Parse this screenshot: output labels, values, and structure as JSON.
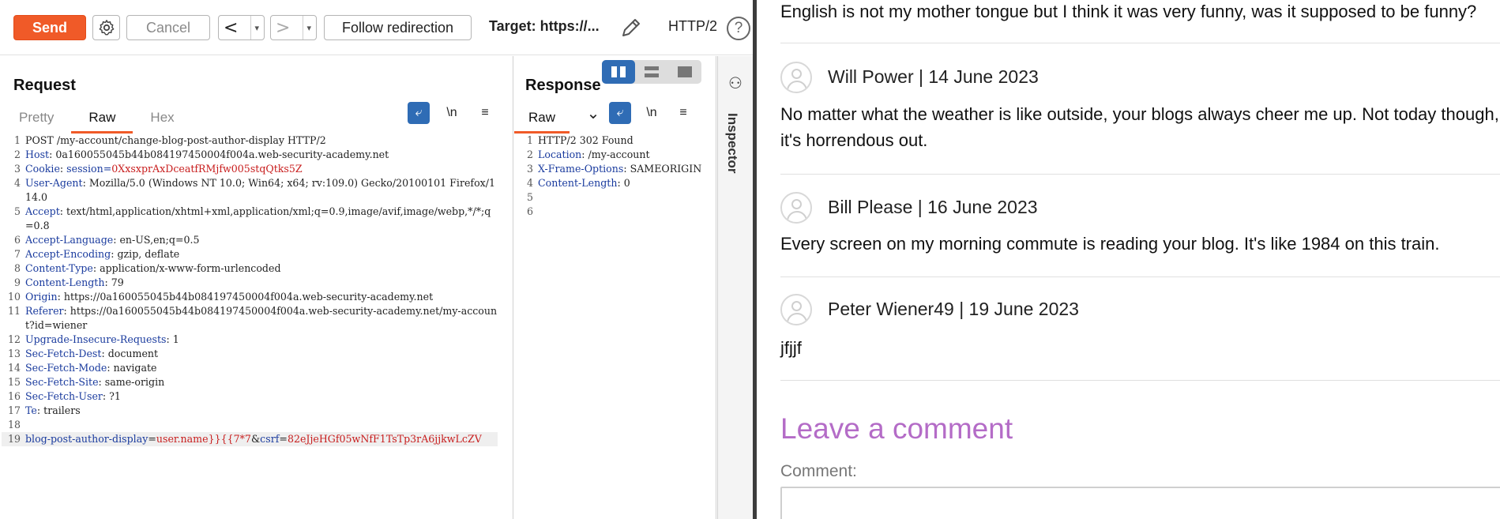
{
  "toolbar": {
    "send_label": "Send",
    "cancel_label": "Cancel",
    "back_label": "<",
    "forward_label": ">",
    "caret": "▾",
    "follow_label": "Follow redirection",
    "target_label": "Target: https://...",
    "http_version": "HTTP/2",
    "help_label": "?"
  },
  "request": {
    "title": "Request",
    "tabs": [
      {
        "label": "Pretty",
        "active": false
      },
      {
        "label": "Raw",
        "active": true
      },
      {
        "label": "Hex",
        "active": false
      }
    ],
    "wrap_icon": "⤶",
    "newline_icon": "\\n",
    "menu_icon": "≡",
    "lines": [
      {
        "n": "1",
        "text": "POST /my-account/change-blog-post-author-display HTTP/2"
      },
      {
        "n": "2",
        "name": "Host",
        "value": " 0a160055045b44b084197450004f004a.web-security-academy.net"
      },
      {
        "n": "3",
        "name": "Cookie",
        "value_prefix": " session=",
        "value": "0XxsxprAxDceatfRMjfw005stqQtks5Z"
      },
      {
        "n": "4",
        "name": "User-Agent",
        "value": " Mozilla/5.0 (Windows NT 10.0; Win64; x64; rv:109.0) Gecko/20100101 Firefox/114.0"
      },
      {
        "n": "5",
        "name": "Accept",
        "value": " text/html,application/xhtml+xml,application/xml;q=0.9,image/avif,image/webp,*/*;q=0.8"
      },
      {
        "n": "6",
        "name": "Accept-Language",
        "value": " en-US,en;q=0.5"
      },
      {
        "n": "7",
        "name": "Accept-Encoding",
        "value": " gzip, deflate"
      },
      {
        "n": "8",
        "name": "Content-Type",
        "value": " application/x-www-form-urlencoded"
      },
      {
        "n": "9",
        "name": "Content-Length",
        "value": " 79"
      },
      {
        "n": "10",
        "name": "Origin",
        "value": " https://0a160055045b44b084197450004f004a.web-security-academy.net"
      },
      {
        "n": "11",
        "name": "Referer",
        "value": " https://0a160055045b44b084197450004f004a.web-security-academy.net/my-account?id=wiener"
      },
      {
        "n": "12",
        "name": "Upgrade-Insecure-Requests",
        "value": " 1"
      },
      {
        "n": "13",
        "name": "Sec-Fetch-Dest",
        "value": " document"
      },
      {
        "n": "14",
        "name": "Sec-Fetch-Mode",
        "value": " navigate"
      },
      {
        "n": "15",
        "name": "Sec-Fetch-Site",
        "value": " same-origin"
      },
      {
        "n": "16",
        "name": "Sec-Fetch-User",
        "value": " ?1"
      },
      {
        "n": "17",
        "name": "Te",
        "value": " trailers"
      },
      {
        "n": "18",
        "text": ""
      }
    ],
    "body_line": {
      "n": "19",
      "p1_name": "blog-post-author-display",
      "p1_value": "user.name}}{{7*7",
      "p2_name": "csrf",
      "p2_value": "82eJjeHGf05wNfF1TsTp3rA6jjkwLcZV"
    }
  },
  "response": {
    "title": "Response",
    "tab_label": "Raw",
    "dropdown_icon": "⌄",
    "wrap_icon": "⤶",
    "newline_icon": "\\n",
    "menu_icon": "≡",
    "lines": [
      {
        "n": "1",
        "text": "HTTP/2 302 Found"
      },
      {
        "n": "2",
        "name": "Location",
        "value": " /my-account"
      },
      {
        "n": "3",
        "name": "X-Frame-Options",
        "value": " SAMEORIGIN"
      },
      {
        "n": "4",
        "name": "Content-Length",
        "value": " 0"
      },
      {
        "n": "5",
        "text": ""
      },
      {
        "n": "6",
        "text": ""
      }
    ]
  },
  "inspector": {
    "label": "Inspector",
    "icon": "⚇"
  },
  "page": {
    "top_text": "English is not my mother tongue but I think it was very funny, was it supposed to be funny?",
    "comments": [
      {
        "author": "Will Power | 14 June 2023",
        "lines": [
          "No matter what the weather is like outside, your blogs always cheer me up. Not today though,",
          "it's horrendous out."
        ]
      },
      {
        "author": "Bill Please | 16 June 2023",
        "lines": [
          "Every screen on my morning commute is reading your blog. It's like 1984 on this train."
        ]
      },
      {
        "author": "Peter Wiener49 | 19 June 2023",
        "lines": [
          "jfjjf"
        ]
      }
    ],
    "leave_title": "Leave a comment",
    "comment_label": "Comment:"
  },
  "colors": {
    "send": "#f05a28",
    "accent_blue": "#2f6cb5",
    "header_name": "#1a3b9e",
    "value_red": "#c81d1d",
    "leave_title": "#b46cc7"
  }
}
